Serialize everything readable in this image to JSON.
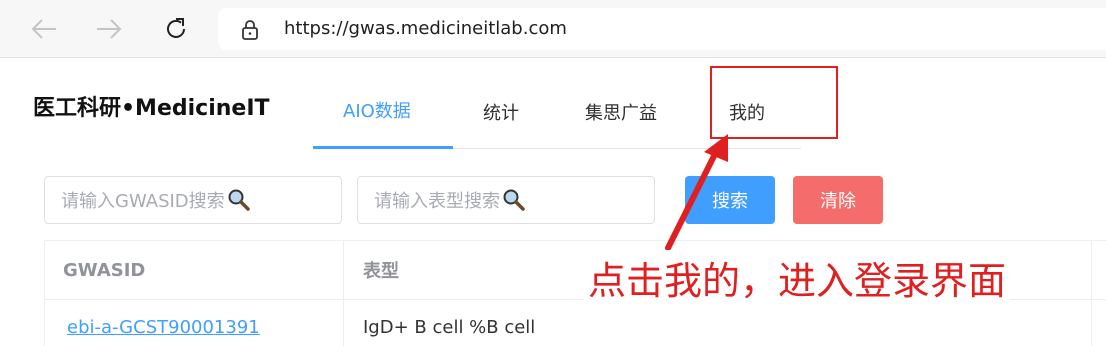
{
  "browser": {
    "url": "https://gwas.medicineitlab.com",
    "icons": [
      "back-arrow-icon",
      "forward-arrow-icon",
      "reload-icon",
      "lock-icon"
    ]
  },
  "site": {
    "title": "医工科研•MedicineIT"
  },
  "tabs": [
    {
      "label": "AIO数据",
      "active": true
    },
    {
      "label": "统计",
      "active": false
    },
    {
      "label": "集思广益",
      "active": false
    },
    {
      "label": "我的",
      "active": false
    }
  ],
  "search": {
    "gwasid_placeholder": "请输入GWASID搜索",
    "trait_placeholder": "请输入表型搜索",
    "search_label": "搜索",
    "clear_label": "清除"
  },
  "table": {
    "columns": [
      "GWASID",
      "表型"
    ],
    "rows": [
      {
        "gwasid": "ebi-a-GCST90001391",
        "trait": "IgD+ B cell %B cell"
      }
    ]
  },
  "annotation": {
    "text": "点击我的，进入登录界面",
    "color": "#e02020"
  },
  "colors": {
    "primary": "#409eff",
    "danger": "#f56c6c"
  }
}
